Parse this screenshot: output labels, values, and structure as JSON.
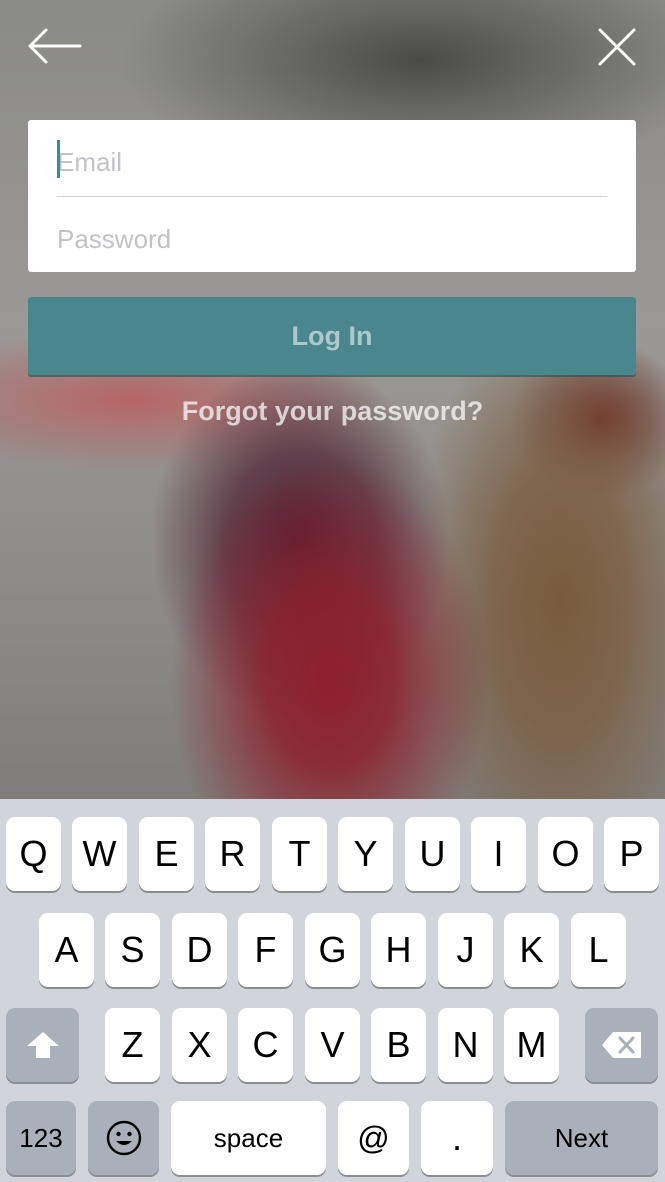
{
  "nav": {
    "back_icon": "arrow-left-icon",
    "close_icon": "close-icon"
  },
  "login_form": {
    "email_placeholder": "Email",
    "email_value": "",
    "password_placeholder": "Password",
    "password_value": "",
    "login_label": "Log In",
    "forgot_label": "Forgot your password?"
  },
  "colors": {
    "accent": "#49868d",
    "caret": "#3b8b97",
    "keyboard_bg": "#d1d5db"
  },
  "keyboard": {
    "row1": [
      "Q",
      "W",
      "E",
      "R",
      "T",
      "Y",
      "U",
      "I",
      "O",
      "P"
    ],
    "row2": [
      "A",
      "S",
      "D",
      "F",
      "G",
      "H",
      "J",
      "K",
      "L"
    ],
    "row3": [
      "Z",
      "X",
      "C",
      "V",
      "B",
      "N",
      "M"
    ],
    "shift_icon": "shift-arrow-icon",
    "delete_icon": "backspace-icon",
    "numbers_label": "123",
    "emoji_icon": "emoji-icon",
    "space_label": "space",
    "at_label": "@",
    "dot_label": ".",
    "next_label": "Next"
  }
}
